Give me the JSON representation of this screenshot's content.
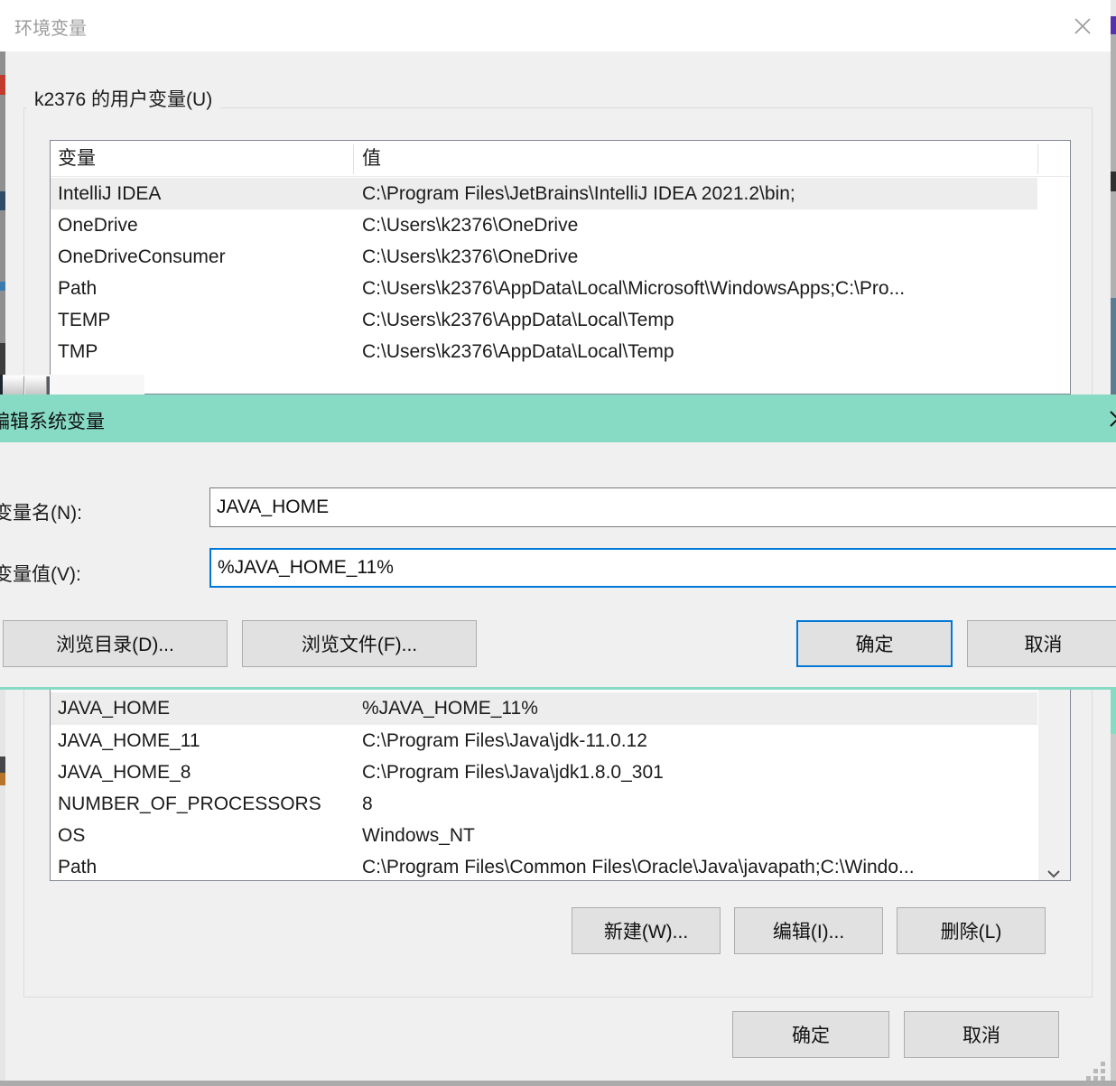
{
  "colors": {
    "accent_blue": "#0078d7",
    "teal_titlebar": "#87dbc5",
    "selection_gray": "#ededed"
  },
  "main_window": {
    "title": "环境变量",
    "user_section": {
      "label": "k2376 的用户变量(U)",
      "col_variable": "变量",
      "col_value": "值",
      "rows": [
        {
          "name": "IntelliJ IDEA",
          "value": "C:\\Program Files\\JetBrains\\IntelliJ IDEA 2021.2\\bin;"
        },
        {
          "name": "OneDrive",
          "value": "C:\\Users\\k2376\\OneDrive"
        },
        {
          "name": "OneDriveConsumer",
          "value": "C:\\Users\\k2376\\OneDrive"
        },
        {
          "name": "Path",
          "value": "C:\\Users\\k2376\\AppData\\Local\\Microsoft\\WindowsApps;C:\\Pro..."
        },
        {
          "name": "TEMP",
          "value": "C:\\Users\\k2376\\AppData\\Local\\Temp"
        },
        {
          "name": "TMP",
          "value": "C:\\Users\\k2376\\AppData\\Local\\Temp"
        }
      ]
    },
    "system_section": {
      "rows": [
        {
          "name": "JAVA_HOME",
          "value": "%JAVA_HOME_11%"
        },
        {
          "name": "JAVA_HOME_11",
          "value": "C:\\Program Files\\Java\\jdk-11.0.12"
        },
        {
          "name": "JAVA_HOME_8",
          "value": "C:\\Program Files\\Java\\jdk1.8.0_301"
        },
        {
          "name": "NUMBER_OF_PROCESSORS",
          "value": "8"
        },
        {
          "name": "OS",
          "value": "Windows_NT"
        },
        {
          "name": "Path",
          "value": "C:\\Program Files\\Common Files\\Oracle\\Java\\javapath;C:\\Windo..."
        }
      ],
      "new_button": "新建(W)...",
      "edit_button": "编辑(I)...",
      "delete_button": "删除(L)"
    },
    "ok_button": "确定",
    "cancel_button": "取消"
  },
  "edit_dialog": {
    "title": "编辑系统变量",
    "name_label": "变量名(N):",
    "name_value": "JAVA_HOME",
    "value_label": "变量值(V):",
    "value_value": "%JAVA_HOME_11%",
    "browse_dir_button": "浏览目录(D)...",
    "browse_file_button": "浏览文件(F)...",
    "ok_button": "确定",
    "cancel_button": "取消"
  }
}
